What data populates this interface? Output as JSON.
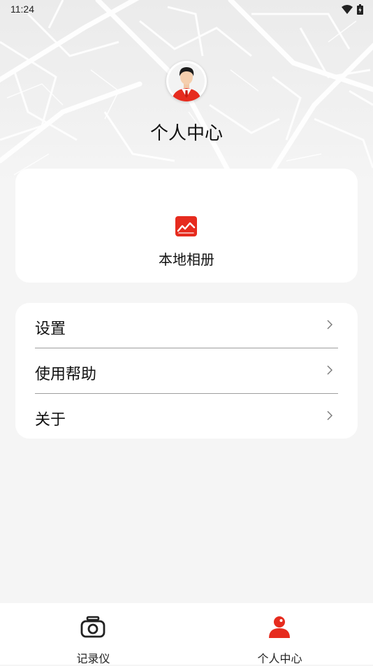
{
  "status_bar": {
    "time": "11:24",
    "icons": [
      "wifi-icon",
      "battery-icon"
    ]
  },
  "header": {
    "title": "个人中心",
    "avatar_icon": "user-avatar"
  },
  "album": {
    "label": "本地相册",
    "icon": "gallery-icon",
    "icon_color": "#e62b1e"
  },
  "menu": {
    "items": [
      {
        "label": "设置",
        "icon": "chevron-right-icon"
      },
      {
        "label": "使用帮助",
        "icon": "chevron-right-icon"
      },
      {
        "label": "关于",
        "icon": "chevron-right-icon"
      }
    ]
  },
  "bottom_nav": {
    "items": [
      {
        "label": "记录仪",
        "icon": "camera-icon",
        "active": false
      },
      {
        "label": "个人中心",
        "icon": "person-icon",
        "active": true
      }
    ],
    "active_color": "#e62b1e",
    "inactive_color": "#222222"
  }
}
